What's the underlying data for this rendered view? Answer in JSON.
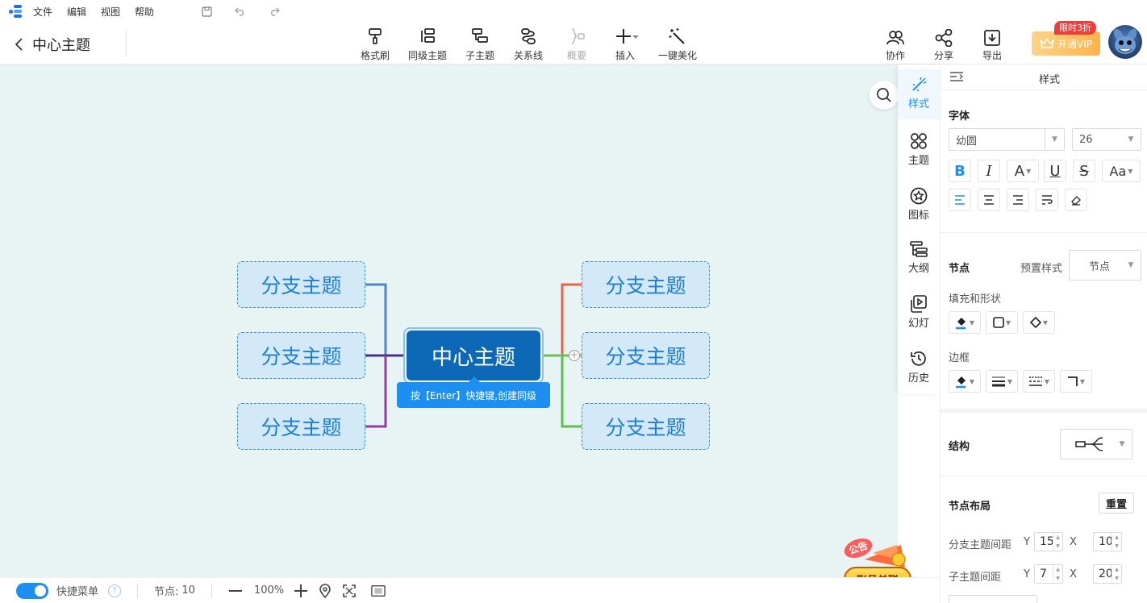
{
  "menubar": {
    "items": [
      "文件",
      "编辑",
      "视图",
      "帮助"
    ]
  },
  "header": {
    "doc_title": "中心主题"
  },
  "toolbar": {
    "tools": [
      "格式刷",
      "同级主题",
      "子主题",
      "关系线",
      "概要",
      "插入",
      "一键美化"
    ],
    "right_tools": [
      "协作",
      "分享",
      "导出"
    ],
    "vip_label": "开通VIP",
    "vip_badge": "限时3折"
  },
  "mindmap": {
    "center": "中心主题",
    "branches_left": [
      "分支主题",
      "分支主题",
      "分支主题"
    ],
    "branches_right": [
      "分支主题",
      "分支主题",
      "分支主题"
    ],
    "hint": "按【Enter】快捷键,创建同级",
    "colors": {
      "left": [
        "#4a86c8",
        "#4b2e8a",
        "#8e3fa0"
      ],
      "right": [
        "#e8624a",
        "#6bbf59",
        "#5bbf4a"
      ],
      "center_fill": "#0e68b8",
      "branch_fill": "#d3e9f8"
    }
  },
  "bottombar": {
    "quick_menu_label": "快捷菜单",
    "quick_menu_on": true,
    "node_count_label": "节点:",
    "node_count": "10",
    "zoom": "100%"
  },
  "notice": {
    "badge": "公告",
    "button": "账号关联"
  },
  "rail": {
    "items": [
      "样式",
      "主题",
      "图标",
      "大纲",
      "幻灯",
      "历史"
    ],
    "active": "样式"
  },
  "panel": {
    "title": "样式",
    "font_section": "字体",
    "font_family": "幼圆",
    "font_size": "26",
    "node_section": "节点",
    "preset_label": "预置样式",
    "preset_value": "节点",
    "fill_shape_label": "填充和形状",
    "border_label": "边框",
    "structure_label": "结构",
    "layout_section": "节点布局",
    "reset_label": "重置",
    "branch_spacing_label": "分支主题间距",
    "branch_spacing_y": "15",
    "branch_spacing_x": "10",
    "sub_spacing_label": "子主题间距",
    "sub_spacing_y": "7",
    "sub_spacing_x": "20",
    "y_label": "Y",
    "x_label": "X"
  }
}
